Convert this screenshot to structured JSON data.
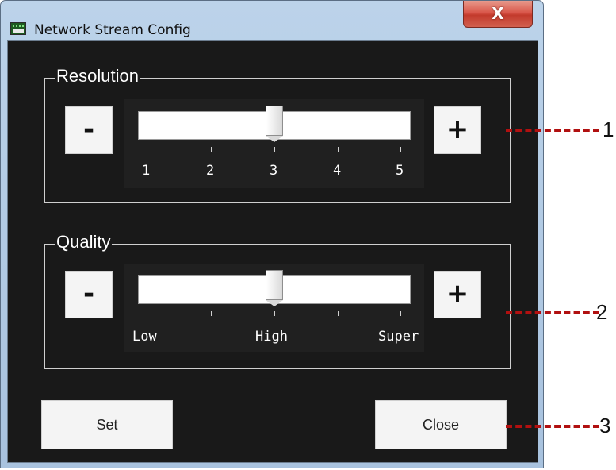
{
  "window": {
    "title": "Network Stream Config",
    "close_symbol": "X"
  },
  "resolution": {
    "label": "Resolution",
    "minus": "-",
    "plus": "+",
    "ticks": [
      "1",
      "2",
      "3",
      "4",
      "5"
    ],
    "value": "3"
  },
  "quality": {
    "label": "Quality",
    "minus": "-",
    "plus": "+",
    "ticks": [
      "Low",
      "High",
      "Super"
    ],
    "value": "High"
  },
  "buttons": {
    "set": "Set",
    "close": "Close"
  },
  "callouts": [
    "1",
    "2",
    "3"
  ],
  "colors": {
    "client_bg": "#191919",
    "callout": "#b11010",
    "frame": "#a8c2de"
  }
}
